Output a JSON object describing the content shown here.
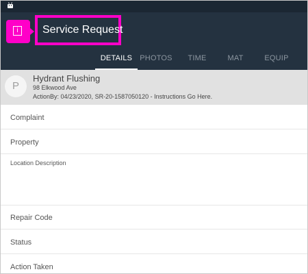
{
  "app_bar": {
    "title": "Service Request",
    "info_icon": "info-icon",
    "info_glyph": "i"
  },
  "status_bar": {
    "icon": "android-icon"
  },
  "tabs": [
    {
      "label": "DETAILS",
      "active": true
    },
    {
      "label": "PHOTOS",
      "active": false
    },
    {
      "label": "TIME",
      "active": false
    },
    {
      "label": "MAT",
      "active": false
    },
    {
      "label": "EQUIP",
      "active": false
    }
  ],
  "request": {
    "avatar_letter": "P",
    "title": "Hydrant Flushing",
    "address": "98 Elkwood Ave",
    "action_line": "ActionBy: 04/23/2020, SR-20-1587050120 - Instructions Go Here."
  },
  "fields": {
    "complaint": "Complaint",
    "property": "Property",
    "location_description": "Location Description",
    "repair_code": "Repair Code",
    "status": "Status",
    "action_taken": "Action Taken"
  },
  "colors": {
    "app_bar": "#243240",
    "highlight": "#ff00c8",
    "header_card": "#e1e1e1"
  }
}
